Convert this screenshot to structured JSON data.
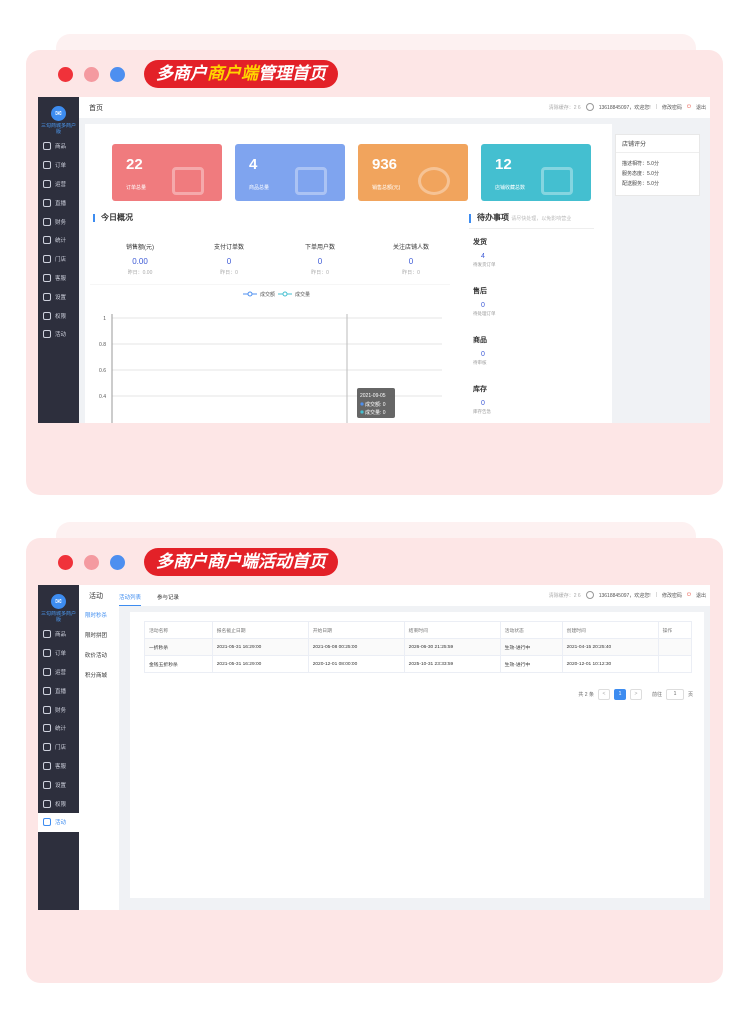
{
  "card1": {
    "title_pre": "多商户",
    "title_hl": "商户端",
    "title_post": "管理首页",
    "sidebar": {
      "logo": "✉",
      "brand": "三勾商城多商户版",
      "items": [
        "商品",
        "订单",
        "运营",
        "直播",
        "财务",
        "统计",
        "门店",
        "客服",
        "设置",
        "权限",
        "活动"
      ]
    },
    "topbar": {
      "title": "首页",
      "clear": "清除缓存：2 6",
      "user": "13618845097，欢迎您!",
      "sep": "|",
      "change_pwd": "修改密码",
      "logout": "退出"
    },
    "stats": [
      {
        "value": "22",
        "label": "订单总量",
        "color": "#f07b7e"
      },
      {
        "value": "4",
        "label": "商品总量",
        "color": "#7fa4ef"
      },
      {
        "value": "936",
        "label": "销售总额(元)",
        "color": "#f1a45d"
      },
      {
        "value": "12",
        "label": "店铺收藏总数",
        "color": "#44bfd0"
      }
    ],
    "overview": {
      "title": "今日概况",
      "kpis": [
        {
          "t": "销售额(元)",
          "n": "0.00",
          "y": "昨日：0.00"
        },
        {
          "t": "支付订单数",
          "n": "0",
          "y": "昨日：0"
        },
        {
          "t": "下单用户数",
          "n": "0",
          "y": "昨日：0"
        },
        {
          "t": "关注店铺人数",
          "n": "0",
          "y": "昨日：0"
        }
      ],
      "legend": [
        "成交额",
        "成交量"
      ],
      "yticks": [
        "1",
        "0.8",
        "0.6",
        "0.4"
      ],
      "tooltip": {
        "date": "2021-09-05",
        "l1": "成交额: 0",
        "l2": "成交量: 0"
      }
    },
    "todo": {
      "title": "待办事项",
      "hint": "请尽快处理，以免影响营业",
      "items": [
        {
          "h": "发货",
          "c": "4",
          "s": "待发货订单"
        },
        {
          "h": "售后",
          "c": "0",
          "s": "待处理订单"
        },
        {
          "h": "商品",
          "c": "0",
          "s": "待审核"
        },
        {
          "h": "库存",
          "c": "0",
          "s": "库存告急"
        }
      ]
    },
    "rating": {
      "title": "店铺评分",
      "rows": [
        "描述相符：5.0分",
        "服务态度：5.0分",
        "配送服务：5.0分"
      ]
    }
  },
  "card2": {
    "title": "多商户商户端活动首页",
    "sidebar": {
      "logo": "✉",
      "brand": "三勾商城多商户版",
      "items": [
        "商品",
        "订单",
        "运营",
        "直播",
        "财务",
        "统计",
        "门店",
        "客服",
        "设置",
        "权限",
        "活动"
      ]
    },
    "header": {
      "title": "活动",
      "tabs": [
        "活动列表",
        "参与记录"
      ],
      "clear": "清除缓存：2 6",
      "user": "13618845097，欢迎您!",
      "sep": "|",
      "change_pwd": "修改密码",
      "logout": "退出"
    },
    "subnav": [
      "限时秒杀",
      "限时拼团",
      "砍价活动",
      "积分商城"
    ],
    "table": {
      "headers": [
        "活动名称",
        "报名截止日期",
        "开始日期",
        "结束时间",
        "活动状态",
        "创建时间",
        "操作"
      ],
      "rows": [
        [
          "一折秒杀",
          "2021-05-31 16:29:00",
          "2021-05-08 00:25:00",
          "2026-06-30 21:25:59",
          "生效-进行中",
          "2021-04-15 20:25:40",
          ""
        ],
        [
          "金钱五折秒杀",
          "2021-05-31 16:29:00",
          "2020-12-01 08:00:00",
          "2025-10-31 23:33:59",
          "生效-进行中",
          "2020-12-01 10:12:30",
          ""
        ]
      ]
    },
    "pager": {
      "total": "共 2 条",
      "prev": "<",
      "page": "1",
      "next": ">",
      "goto": "前往",
      "goto_val": "1",
      "unit": "页"
    }
  }
}
